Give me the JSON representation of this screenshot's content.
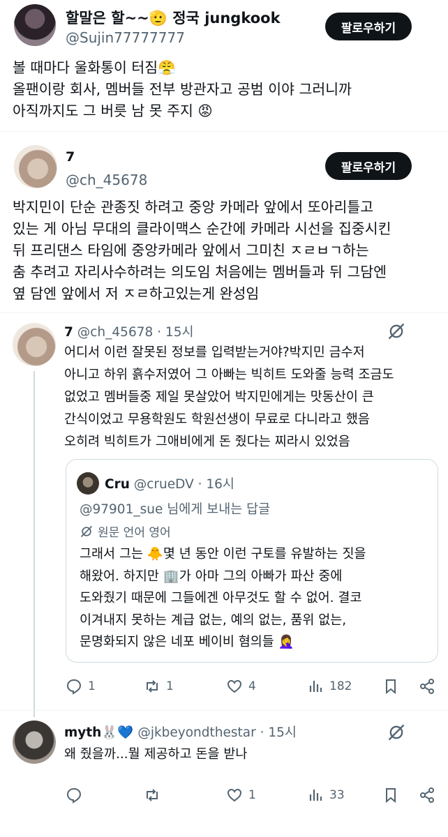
{
  "post1": {
    "name": "할말은 할~~🫡 정국 jungkook",
    "handle": "@Sujin77777777",
    "follow_label": "팔로우하기",
    "lines": [
      "볼 때마다 울화통이 터짐😤",
      "올팬이랑 회사, 멤버들 전부 방관자고 공범 이야 그러니까",
      "아직까지도 그 버릇 남 못 주지 😡"
    ]
  },
  "post2": {
    "name": "7",
    "handle": "@ch_45678",
    "follow_label": "팔로우하기",
    "lines": [
      "박지민이 단순 관종짓 하려고 중앙 카메라 앞에서 또아리틀고",
      "있는 게 아님 무대의 클라이맥스 순간에 카메라 시선을 집중시킨",
      "뒤 프리댄스 타임에 중앙카메라 앞에서 그미친 ㅈㄹㅂㄱ하는",
      "춤 추려고 자리사수하려는 의도임 처음에는 멤버들과 뒤 그담엔",
      "옆 담엔 앞에서 저 ㅈㄹ하고있는게 완성임"
    ]
  },
  "reply1": {
    "name": "7",
    "handle": "@ch_45678",
    "time": "· 15시",
    "lines": [
      "어디서 이런 잘못된 정보를 입력받는거야?박지민 금수저",
      "아니고 하위 흙수저였어 그 아빠는 빅히트 도와줄 능력 조금도",
      "없었고 멤버들중 제일 못살았어 박지민에게는 맛동산이 큰",
      "간식이었고 무용학원도 학원선생이 무료로 다니라고 했음",
      "오히려 빅히트가 그애비에게 돈 줬다는 찌라시 있었음"
    ],
    "quote": {
      "name": "Cru",
      "handle": "@crueDV",
      "time": "· 16시",
      "reply_to": "@97901_sue 님에게 보내는 답글",
      "translate": "원문 언어 영어",
      "lines": [
        "그래서 그는 🐥몇 년 동안 이런 구토를 유발하는 짓을",
        "해왔어. 하지만 🏢가 아마 그의 아빠가 파산 중에",
        "도와줬기 때문에 그들에겐 아무것도 할 수 없어. 결코",
        "이겨내지 못하는 계급 없는, 예의 없는, 품위 없는,",
        "문명화되지 않은 네포 베이비 혐의들 🤦‍♀️"
      ]
    },
    "actions": {
      "replies": "1",
      "reposts": "1",
      "likes": "4",
      "views": "182"
    }
  },
  "reply2": {
    "name": "myth🐰💙",
    "handle": "@jkbeyondthestar",
    "time": "· 15시",
    "text": "왜 줬을까...뭘 제공하고 돈을 받나",
    "actions": {
      "replies": "",
      "reposts": "",
      "likes": "1",
      "views": "33"
    }
  }
}
